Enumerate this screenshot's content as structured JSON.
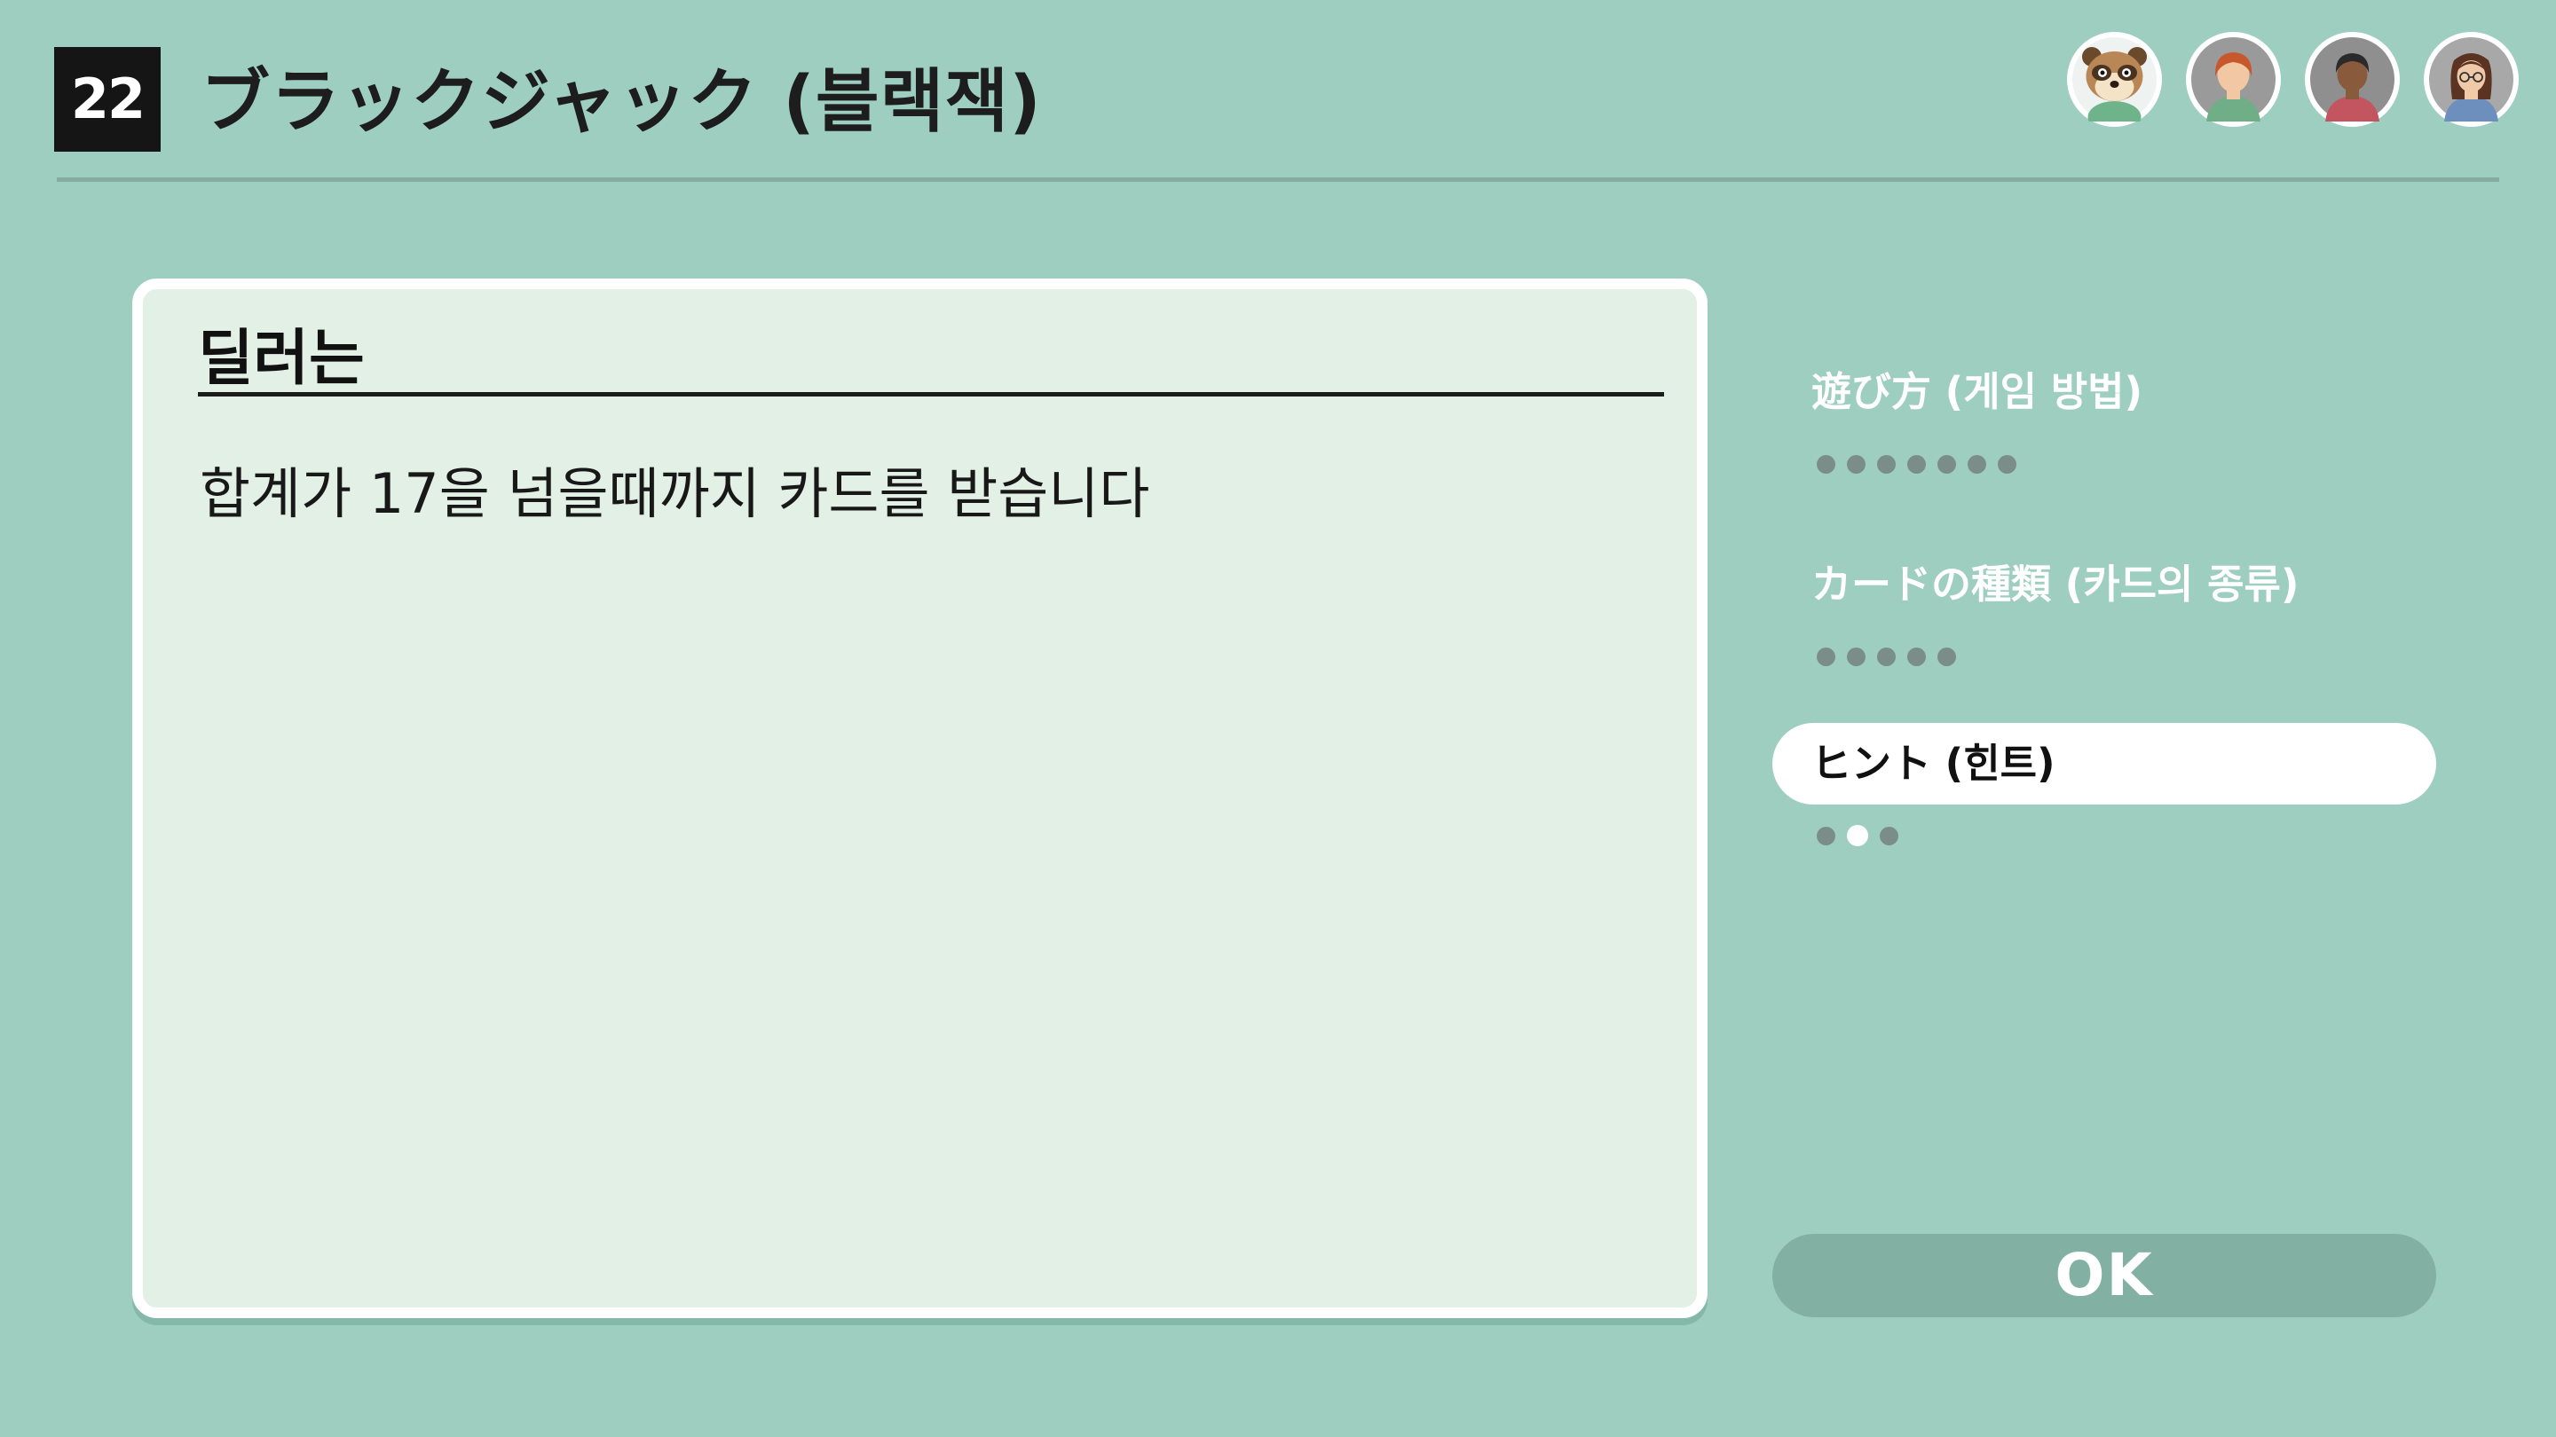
{
  "header": {
    "game_number": "22",
    "title": "ブラックジャック (블랙잭)"
  },
  "players": [
    {
      "name": "raccoon-player-avatar"
    },
    {
      "name": "red-hair-player-avatar"
    },
    {
      "name": "dark-hair-player-avatar"
    },
    {
      "name": "glasses-player-avatar"
    }
  ],
  "panel": {
    "heading": "딜러는",
    "body": "합계가 17을 넘을때까지 카드를 받습니다"
  },
  "menu": {
    "items": [
      {
        "label": "遊び方 (게임 방법)",
        "pages": 7,
        "current_page": null,
        "selected": false
      },
      {
        "label": "カードの種類 (카드의 종류)",
        "pages": 5,
        "current_page": null,
        "selected": false
      },
      {
        "label": "ヒント (힌트)",
        "pages": 3,
        "current_page": 2,
        "selected": true
      }
    ]
  },
  "ok_button": {
    "label": "OK"
  },
  "colors": {
    "background": "#9dcebf",
    "panel": "#e2f0e6",
    "ok_button": "#82b1a3",
    "dot": "#7b8d88"
  }
}
